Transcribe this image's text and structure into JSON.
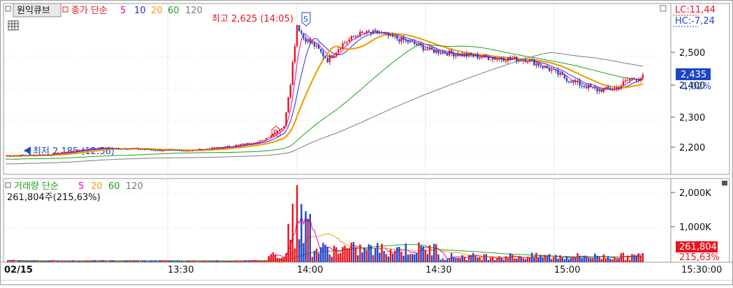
{
  "legend_price": {
    "stock_name": "원익큐브",
    "label": "종가 단순",
    "periods": [
      "5",
      "10",
      "20",
      "60",
      "120"
    ],
    "period_colors": [
      "#e600c8",
      "#1f2fd6",
      "#f2a000",
      "#1e9e1e",
      "#7a7a7a"
    ]
  },
  "legend_volume": {
    "label": "거래량 단순",
    "periods": [
      "5",
      "20",
      "60",
      "120"
    ],
    "period_colors": [
      "#e600c8",
      "#f2a000",
      "#1e9e1e",
      "#7a7a7a"
    ],
    "summary": "261,804주(215,63%)"
  },
  "annotations": {
    "high": "최고 2,625 (14:05)",
    "low": "최저 2,185 (12:56)",
    "sell_marker": "S",
    "buy_marker": "B"
  },
  "right_axis": {
    "lc": "LC:11,44",
    "hc": "HC:-7,24",
    "price_ticks": [
      "2,500",
      "2,400",
      "2,300",
      "2,200"
    ],
    "current_price": "2,435",
    "change_pct": "-1,02%",
    "volume_ticks": [
      "2,000K",
      "1,000K"
    ],
    "current_volume": "261,804",
    "volume_pct": "215,63%"
  },
  "x_axis": {
    "date": "02/15",
    "ticks": [
      "13:30",
      "14:00",
      "14:30",
      "15:00"
    ],
    "end_time": "15:30:00"
  },
  "colors": {
    "up": "#e8141c",
    "down": "#1e45c8",
    "ma5": "#e600c8",
    "ma10": "#1f2fd6",
    "ma20": "#f2a000",
    "ma60": "#1e9e1e",
    "ma120": "#7a7a7a",
    "grid": "#b8b8b8",
    "current_label_bg": "#e8141c"
  },
  "chart_data": {
    "type": "candlestick",
    "price_range": [
      2130,
      2660
    ],
    "volume_range": [
      0,
      2400
    ],
    "volume_unit": "K shares",
    "price_candles_key_points": [
      {
        "time": "12:56",
        "value": 2185,
        "note": "low"
      },
      {
        "time": "13:55",
        "value": 2235
      },
      {
        "time": "14:00",
        "value": 2290
      },
      {
        "time": "14:05",
        "value": 2625,
        "note": "high"
      },
      {
        "time": "14:15",
        "value": 2480
      },
      {
        "time": "14:25",
        "value": 2580
      },
      {
        "time": "14:40",
        "value": 2545
      },
      {
        "time": "15:00",
        "value": 2480
      },
      {
        "time": "15:10",
        "value": 2395
      },
      {
        "time": "15:20",
        "value": 2435,
        "note": "current"
      }
    ],
    "volume_peak": {
      "time": "14:00",
      "value": 2250
    },
    "current_volume": 261804
  }
}
